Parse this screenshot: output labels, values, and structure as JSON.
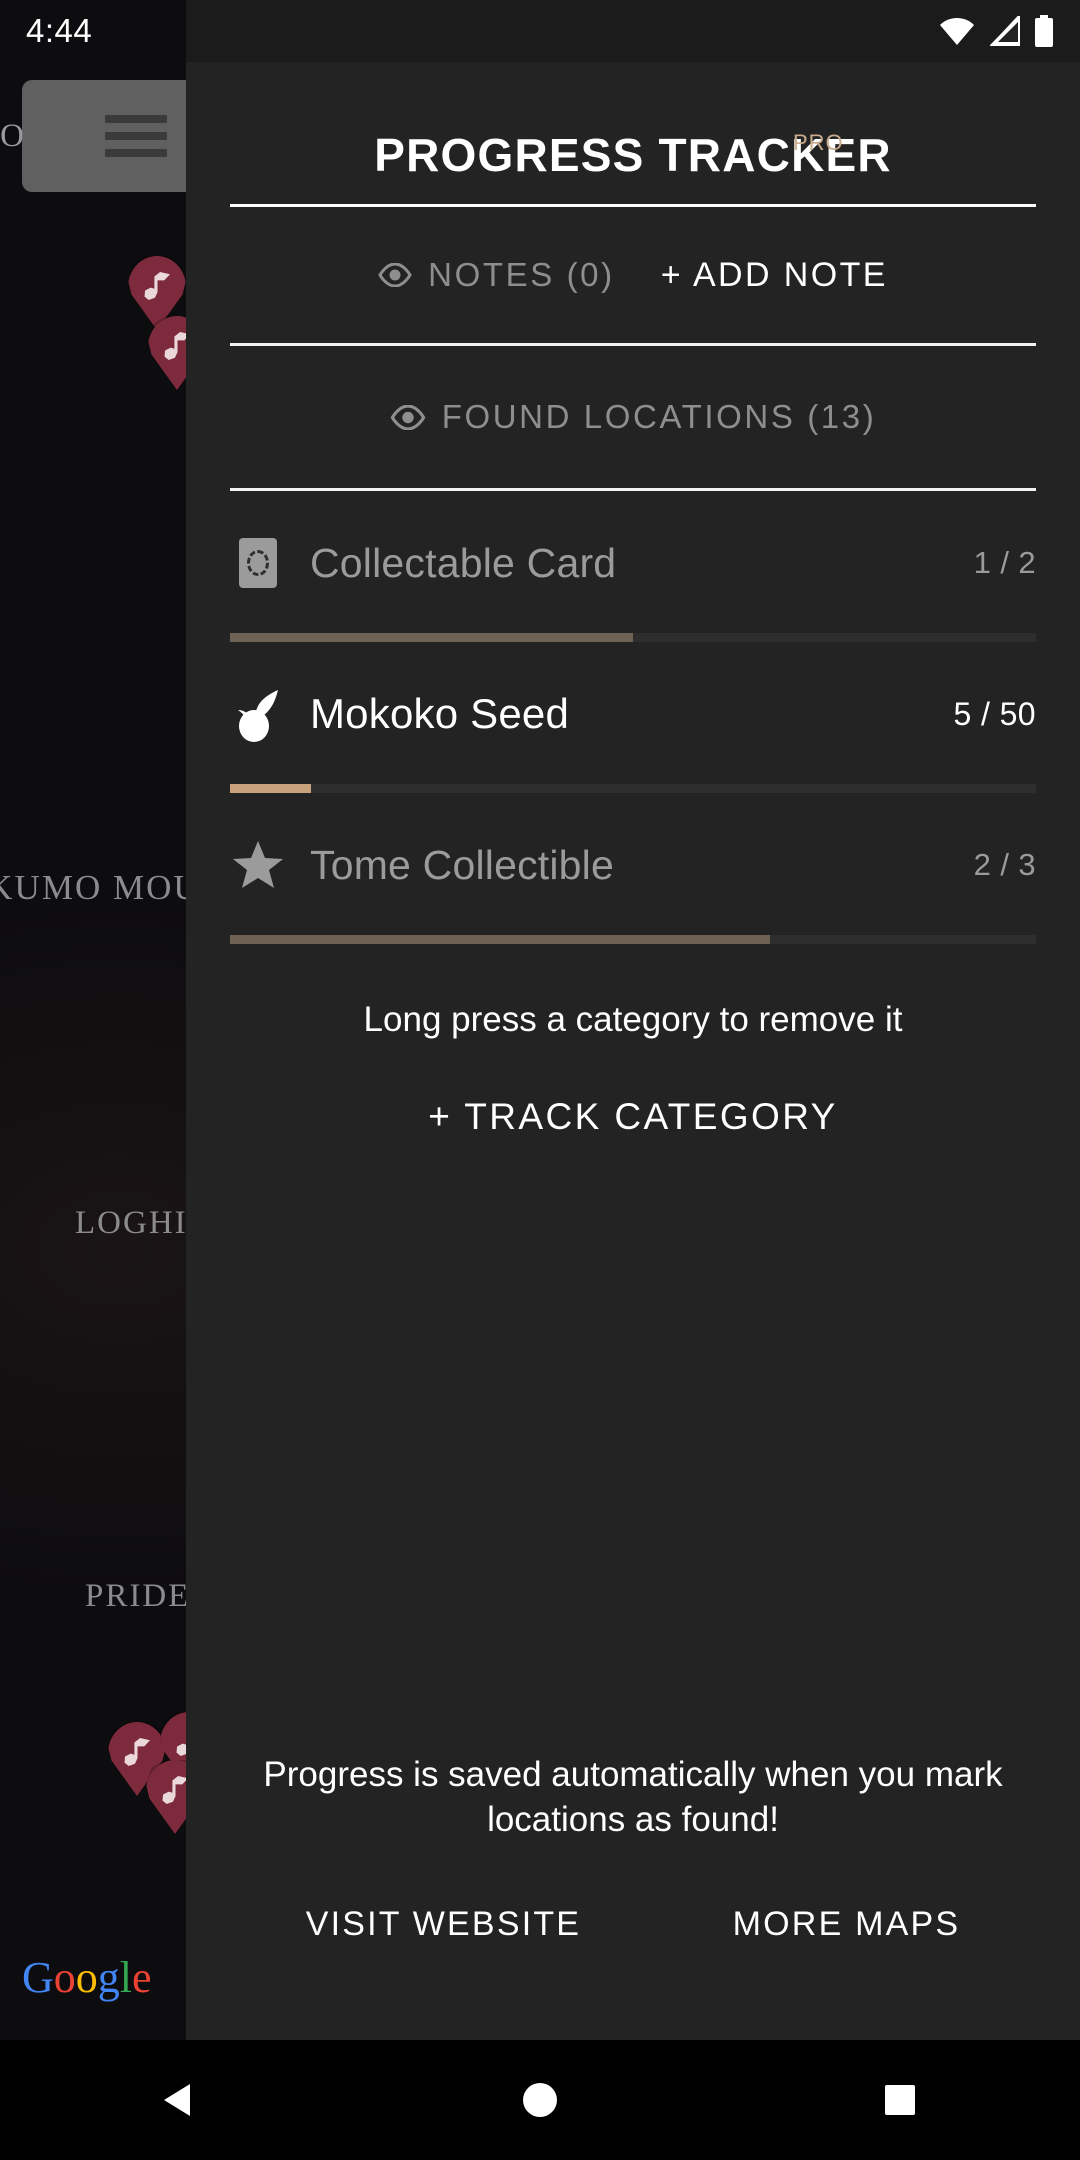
{
  "status_bar": {
    "time": "4:44",
    "icons": [
      "wifi-icon",
      "cellular-signal-icon",
      "battery-icon"
    ]
  },
  "map": {
    "menu_icon": "hamburger-menu-icon",
    "labels": [
      "LO",
      "NKUMO MOU",
      "LOGHI",
      "PRIDEH"
    ],
    "watermark": "Google"
  },
  "panel": {
    "title": "PROGRESS TRACKER",
    "pro_badge": "PRO",
    "notes": {
      "eye_icon": "eye-icon",
      "label": "NOTES (0)",
      "add_label": "+ ADD NOTE"
    },
    "found_locations": {
      "eye_icon": "eye-icon",
      "label": "FOUND LOCATIONS (13)"
    },
    "categories": [
      {
        "icon": "collectable-card-icon",
        "name": "Collectable Card",
        "count": "1 / 2",
        "progress_pct": 50,
        "active": false
      },
      {
        "icon": "mokoko-seed-icon",
        "name": "Mokoko Seed",
        "count": "5 / 50",
        "progress_pct": 10,
        "active": true
      },
      {
        "icon": "star-icon",
        "name": "Tome Collectible",
        "count": "2 / 3",
        "progress_pct": 67,
        "active": false
      }
    ],
    "hint": "Long press a category to remove it",
    "track_category_label": "+ TRACK CATEGORY",
    "save_note": "Progress is saved automatically when you mark locations as found!",
    "footer_links": [
      "VISIT WEBSITE",
      "MORE MAPS"
    ]
  },
  "nav_bar": {
    "back": "back-triangle-icon",
    "home": "home-circle-icon",
    "recents": "recents-square-icon"
  },
  "colors": {
    "panel_bg": "#232323",
    "accent_tan": "#c9a27c",
    "progress_muted": "#6e6254",
    "pro_badge": "#c9ab8e",
    "muted_text": "#8e8e8e"
  }
}
